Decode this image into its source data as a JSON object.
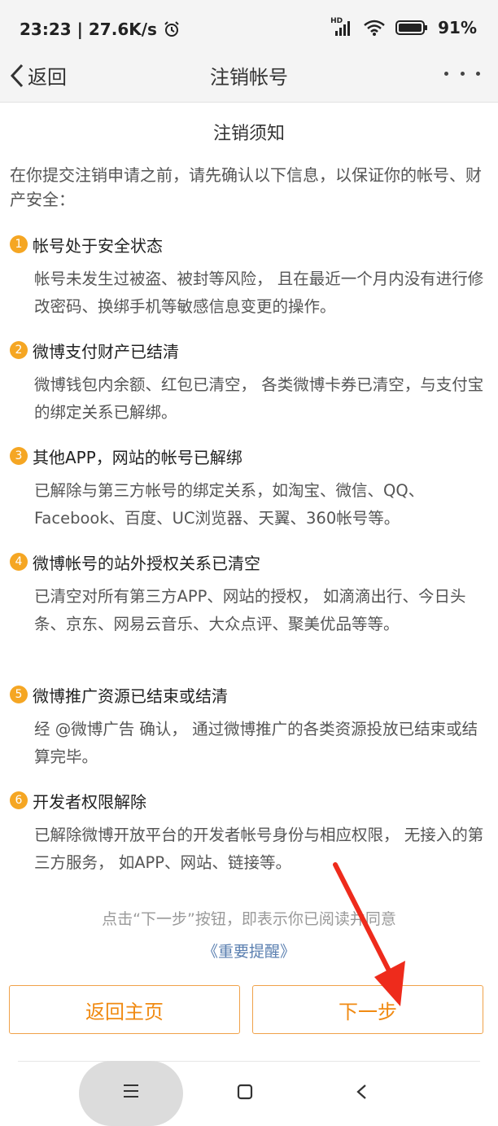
{
  "status": {
    "time_speed": "23:23 | 27.6K/s",
    "hd_label": "HD",
    "battery": "91%"
  },
  "nav": {
    "back_label": "返回",
    "title": "注销帐号"
  },
  "notice": {
    "title": "注销须知",
    "intro": "在你提交注销申请之前，请先确认以下信息，以保证你的帐号、财产安全：",
    "items": [
      {
        "num": "1",
        "title": "帐号处于安全状态",
        "desc": "帐号未发生过被盗、被封等风险， 且在最近一个月内没有进行修改密码、换绑手机等敏感信息变更的操作。"
      },
      {
        "num": "2",
        "title": "微博支付财产已结清",
        "desc": "微博钱包内余额、红包已清空， 各类微博卡券已清空，与支付宝的绑定关系已解绑。"
      },
      {
        "num": "3",
        "title": "其他APP，网站的帐号已解绑",
        "desc": "已解除与第三方帐号的绑定关系，如淘宝、微信、QQ、Facebook、百度、UC浏览器、天翼、360帐号等。"
      },
      {
        "num": "4",
        "title": "微博帐号的站外授权关系已清空",
        "desc": "已清空对所有第三方APP、网站的授权， 如滴滴出行、今日头条、京东、网易云音乐、大众点评、聚美优品等等。"
      },
      {
        "num": "5",
        "title": "微博推广资源已结束或结清",
        "desc": "经 @微博广告 确认， 通过微博推广的各类资源投放已结束或结算完毕。"
      },
      {
        "num": "6",
        "title": "开发者权限解除",
        "desc": "已解除微博开放平台的开发者帐号身份与相应权限， 无接入的第三方服务， 如APP、网站、链接等。"
      }
    ],
    "footer_note": "点击“下一步”按钮，即表示你已阅读并同意",
    "footer_link": "《重要提醒》"
  },
  "buttons": {
    "home": "返回主页",
    "next": "下一步"
  },
  "colors": {
    "accent": "#f08a12",
    "badge": "#f5a623",
    "link": "#5a7fb0",
    "annotation_arrow": "#ee2b1c"
  }
}
